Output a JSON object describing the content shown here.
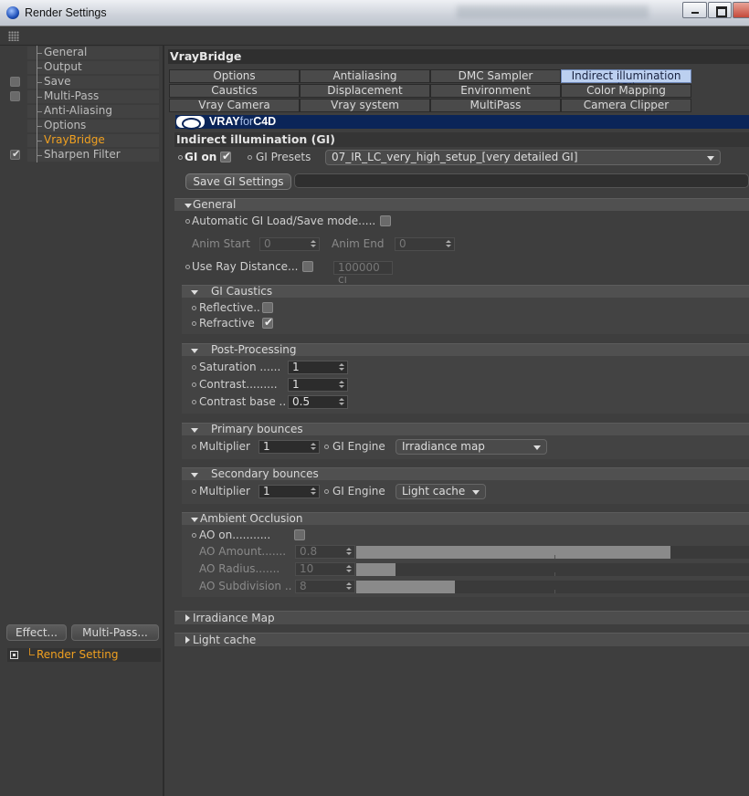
{
  "window": {
    "title": "Render Settings"
  },
  "sidebar": {
    "items": [
      {
        "label": "General",
        "checkbox": false,
        "checked": false,
        "active": false
      },
      {
        "label": "Output",
        "checkbox": false,
        "checked": false,
        "active": false
      },
      {
        "label": "Save",
        "checkbox": true,
        "checked": false,
        "active": false
      },
      {
        "label": "Multi-Pass",
        "checkbox": true,
        "checked": false,
        "active": false
      },
      {
        "label": "Anti-Aliasing",
        "checkbox": false,
        "checked": false,
        "active": false
      },
      {
        "label": "Options",
        "checkbox": false,
        "checked": false,
        "active": false
      },
      {
        "label": "VrayBridge",
        "checkbox": false,
        "checked": false,
        "active": true
      },
      {
        "label": "Sharpen Filter",
        "checkbox": true,
        "checked": true,
        "active": false
      }
    ],
    "effect_button": "Effect...",
    "multipass_button": "Multi-Pass...",
    "render_setting": "Render Setting"
  },
  "main": {
    "header": "VrayBridge",
    "tabs": [
      [
        "Options",
        "Antialiasing",
        "DMC Sampler",
        "Indirect illumination (GI)"
      ],
      [
        "Caustics",
        "Displacement",
        "Environment",
        "Color Mapping"
      ],
      [
        "Vray Camera",
        "Vray system",
        "MultiPass",
        "Camera Clipper"
      ]
    ],
    "active_tab": "Indirect illumination (GI)",
    "banner": {
      "brand_a": "VRAY",
      "brand_b": "for",
      "brand_c": "C4D"
    },
    "section_title": "Indirect illumination (GI)",
    "gi_on_label": "GI on",
    "gi_on": true,
    "gi_presets_label": "GI Presets",
    "gi_presets_value": "07_IR_LC_very_high_setup_[very detailed GI]",
    "save_gi_button": "Save GI Settings",
    "general": {
      "title": "General",
      "auto_gi_label": "Automatic GI Load/Save mode.....",
      "auto_gi": false,
      "anim_start_label": "Anim Start",
      "anim_start_value": "0",
      "anim_end_label": "Anim End",
      "anim_end_value": "0",
      "ray_distance_label": "Use Ray Distance...",
      "ray_distance": false,
      "ray_distance_value": "100000 cı"
    },
    "gi_caustics": {
      "title": "GI Caustics",
      "reflective_label": "Reflective..",
      "reflective": false,
      "refractive_label": "Refractive",
      "refractive": true
    },
    "post_processing": {
      "title": "Post-Processing",
      "saturation_label": "Saturation ......",
      "saturation_value": "1",
      "contrast_label": "Contrast.........",
      "contrast_value": "1",
      "contrast_base_label": "Contrast base ..",
      "contrast_base_value": "0.5"
    },
    "primary_bounces": {
      "title": "Primary bounces",
      "multiplier_label": "Multiplier",
      "multiplier_value": "1",
      "engine_label": "GI Engine",
      "engine_value": "Irradiance map"
    },
    "secondary_bounces": {
      "title": "Secondary bounces",
      "multiplier_label": "Multiplier",
      "multiplier_value": "1",
      "engine_label": "GI Engine",
      "engine_value": "Light cache"
    },
    "ambient_occlusion": {
      "title": "Ambient Occlusion",
      "ao_on_label": "AO on...........",
      "ao_on": false,
      "amount_label": "AO Amount.......",
      "amount_value": "0.8",
      "amount_fraction": 0.8,
      "radius_label": "AO Radius.......",
      "radius_value": "10",
      "radius_fraction": 0.1,
      "subdiv_label": "AO Subdivision ..",
      "subdiv_value": "8",
      "subdiv_fraction": 0.25
    },
    "collapsed_sections": [
      "Irradiance Map",
      "Light cache"
    ]
  },
  "colors": {
    "accent_active": "#f0a020",
    "tab_active_bg": "#bcd0f0",
    "banner_bg": "#0b2558"
  }
}
